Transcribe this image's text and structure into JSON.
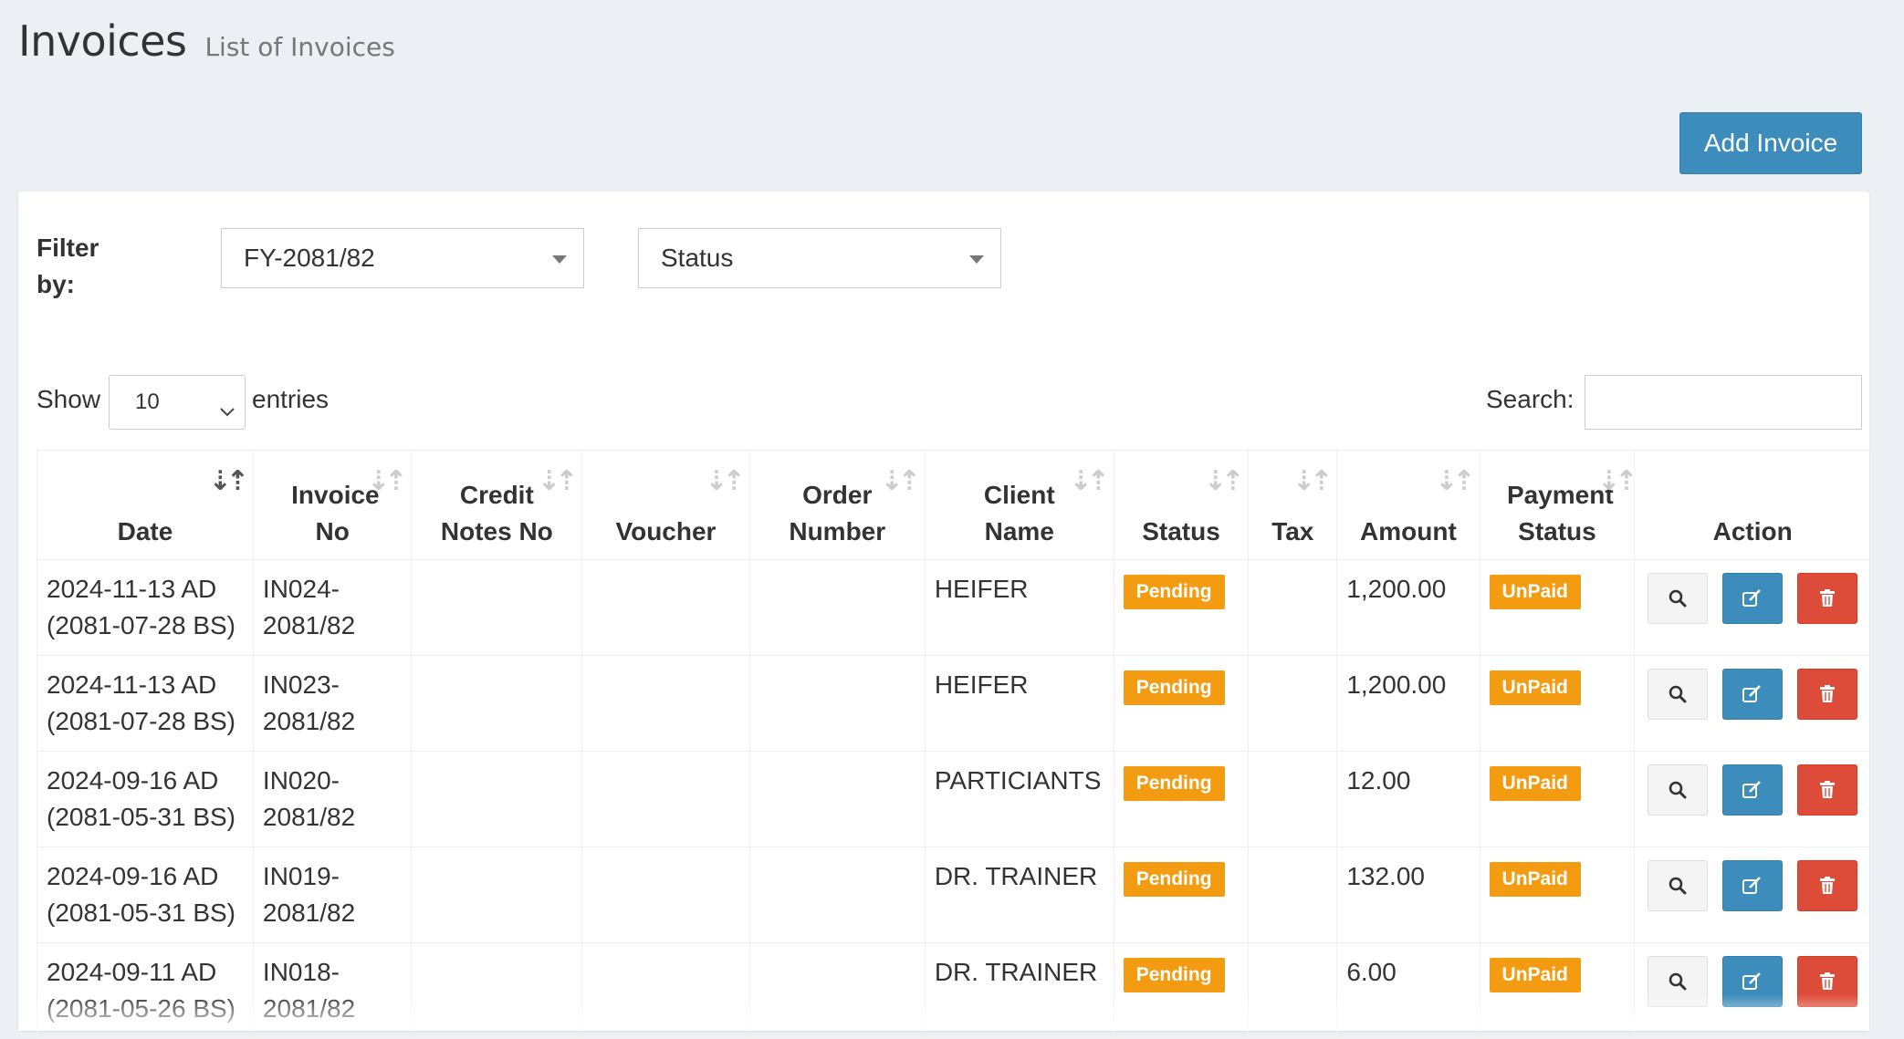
{
  "header": {
    "title": "Invoices",
    "subtitle": "List of Invoices"
  },
  "toolbar": {
    "add_label": "Add Invoice"
  },
  "filter": {
    "label": "Filter by:",
    "fiscal_year": "FY-2081/82",
    "status": "Status"
  },
  "table_controls": {
    "show_label": "Show",
    "page_length": "10",
    "entries_label": "entries",
    "search_label": "Search:",
    "search_value": ""
  },
  "columns": {
    "date": "Date",
    "invoice_no": "Invoice No",
    "credit_notes": "Credit Notes No",
    "voucher": "Voucher",
    "order_number": "Order Number",
    "client_name": "Client Name",
    "status": "Status",
    "tax": "Tax",
    "amount": "Amount",
    "payment_status": "Payment Status",
    "action": "Action"
  },
  "rows": [
    {
      "date_ad": "2024-11-13 AD",
      "date_bs": "(2081-07-28 BS)",
      "invoice_a": "IN024-",
      "invoice_b": "2081/82",
      "credit": "",
      "voucher": "",
      "order": "",
      "client": "HEIFER",
      "status": "Pending",
      "tax": "",
      "amount": "1,200.00",
      "payment": "UnPaid"
    },
    {
      "date_ad": "2024-11-13 AD",
      "date_bs": "(2081-07-28 BS)",
      "invoice_a": "IN023-",
      "invoice_b": "2081/82",
      "credit": "",
      "voucher": "",
      "order": "",
      "client": "HEIFER",
      "status": "Pending",
      "tax": "",
      "amount": "1,200.00",
      "payment": "UnPaid"
    },
    {
      "date_ad": "2024-09-16 AD",
      "date_bs": "(2081-05-31 BS)",
      "invoice_a": "IN020-",
      "invoice_b": "2081/82",
      "credit": "",
      "voucher": "",
      "order": "",
      "client": "PARTICIANTS",
      "status": "Pending",
      "tax": "",
      "amount": "12.00",
      "payment": "UnPaid"
    },
    {
      "date_ad": "2024-09-16 AD",
      "date_bs": "(2081-05-31 BS)",
      "invoice_a": "IN019-",
      "invoice_b": "2081/82",
      "credit": "",
      "voucher": "",
      "order": "",
      "client": "DR. TRAINER",
      "status": "Pending",
      "tax": "",
      "amount": "132.00",
      "payment": "UnPaid"
    },
    {
      "date_ad": "2024-09-11 AD",
      "date_bs": "(2081-05-26 BS)",
      "invoice_a": "IN018-",
      "invoice_b": "2081/82",
      "credit": "",
      "voucher": "",
      "order": "",
      "client": "DR. TRAINER",
      "status": "Pending",
      "tax": "",
      "amount": "6.00",
      "payment": "UnPaid"
    }
  ],
  "icons": {
    "view": "search-icon",
    "edit": "edit-icon",
    "delete": "trash-icon",
    "sort": "sort-icon"
  },
  "colors": {
    "primary": "#3c8dbc",
    "danger": "#dd4b39",
    "warning": "#f39c12",
    "background": "#ecf0f5"
  }
}
